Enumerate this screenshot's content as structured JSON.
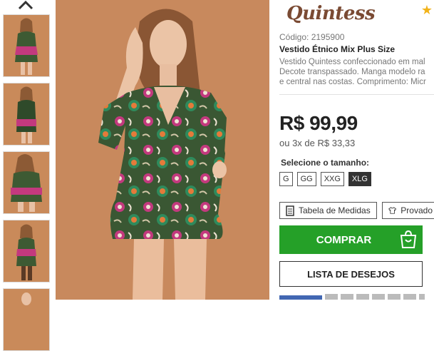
{
  "brand": {
    "name": "Quintess"
  },
  "product": {
    "code_label": "Código: 2195900",
    "title": "Vestido Étnico Mix Plus Size",
    "description_lines": [
      "Vestido Quintess confeccionado em mal",
      "Decote transpassado. Manga modelo ra",
      "e central nas costas. Comprimento: Micr"
    ],
    "price": "R$ 99,99",
    "installments": "ou 3x de R$ 33,33"
  },
  "sizes": {
    "label": "Selecione o tamanho:",
    "options": [
      "G",
      "GG",
      "XXG",
      "XLG"
    ],
    "selected": "XLG"
  },
  "buttons": {
    "size_table": "Tabela de Medidas",
    "virtual_fit": "Provado",
    "buy": "COMPRAR",
    "wishlist": "LISTA DE DESEJOS"
  },
  "colors": {
    "buy_green": "#25a028",
    "brand_brown": "#7a4a33",
    "star_gold": "#f2b31a",
    "photo_background": "#c8895d"
  },
  "icons": {
    "thumbs_up": "chevron-up-icon",
    "favorite": "star-icon",
    "size_table": "document-icon",
    "virtual_fit": "tshirt-icon",
    "buy": "shopping-bag-icon"
  }
}
